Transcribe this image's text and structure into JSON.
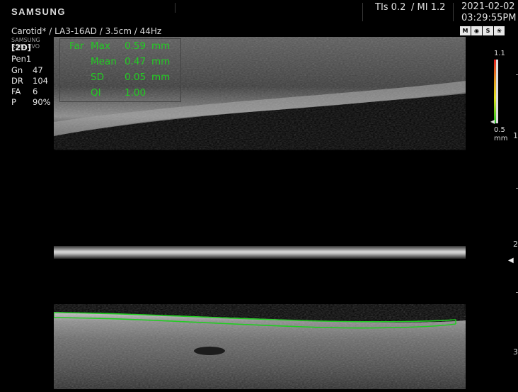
{
  "header": {
    "brand": "SAMSUNG",
    "tis": "TIs 0.2",
    "mi": "/ MI 1.2",
    "date": "2021-02-02",
    "time": "03:29:55PM"
  },
  "probe_line": "Carotid* / LA3-16AD / 3.5cm / 44Hz",
  "watermark": "SAMSUNG RS80 EVO",
  "params": {
    "mode": "[2D]",
    "preset": "Pen1",
    "rows": [
      {
        "label": "Gn",
        "value": "47"
      },
      {
        "label": "DR",
        "value": "104"
      },
      {
        "label": "FA",
        "value": "6"
      },
      {
        "label": "P",
        "value": "90%"
      }
    ]
  },
  "measurement": {
    "wall": "Far",
    "rows": [
      {
        "label": "Max",
        "value": "0.59",
        "unit": "mm"
      },
      {
        "label": "Mean",
        "value": "0.47",
        "unit": "mm"
      },
      {
        "label": "SD",
        "value": "0.05",
        "unit": "mm"
      },
      {
        "label": "QI",
        "value": "1.00",
        "unit": ""
      }
    ]
  },
  "scale": {
    "top": "1.1",
    "bottom": "0.5",
    "unit": "mm"
  },
  "depth_marks": [
    "1",
    "2",
    "3"
  ],
  "colors": {
    "trace": "#22cc22",
    "text": "#e6e6e6"
  },
  "icons": [
    "M",
    "probe-icon",
    "S",
    "biopsy-icon"
  ]
}
